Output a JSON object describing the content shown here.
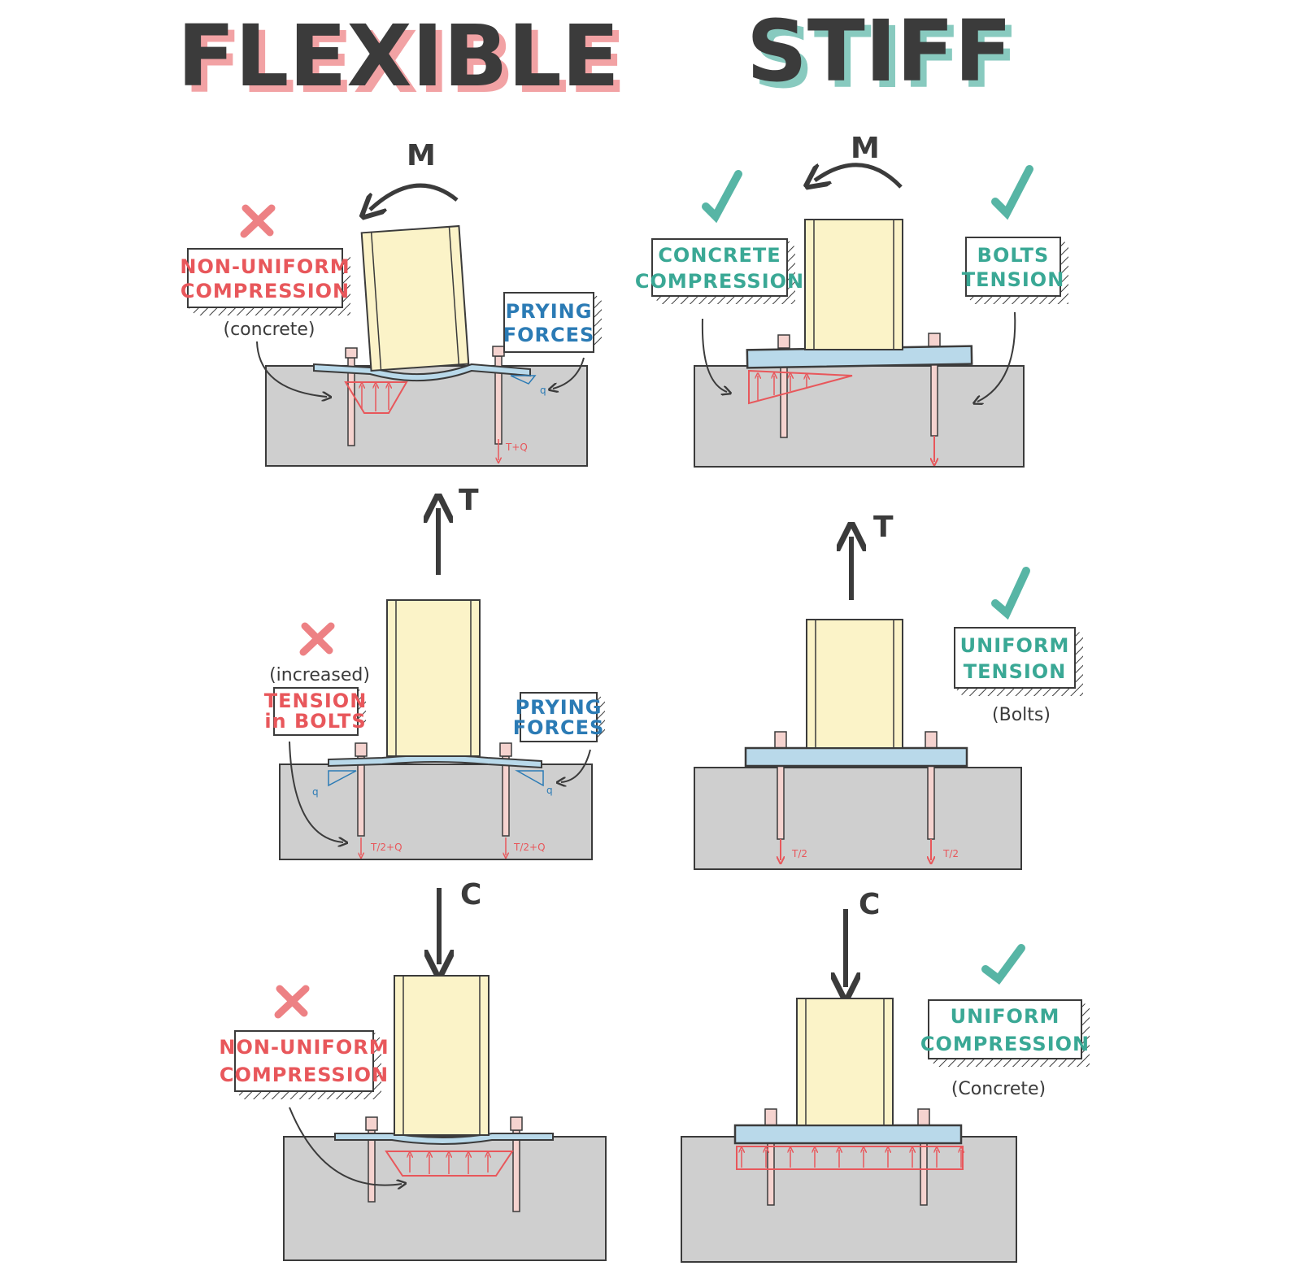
{
  "titles": {
    "left": "FLEXIBLE",
    "right": "STIFF"
  },
  "colors": {
    "flexible": "#e8575b",
    "stiff": "#3aa895",
    "blue": "#2b7bb5",
    "ink": "#3b3b3b",
    "concrete": "#cfcfcf",
    "column": "#fbf3c8",
    "plate": "#b9d9ea",
    "bolt": "#f5d3cf"
  },
  "force_labels": {
    "moment": "M",
    "tension": "T",
    "compression": "C"
  },
  "flexible": {
    "moment": {
      "mark": "x",
      "box_main": [
        "NON-UNIFORM",
        "COMPRESSION"
      ],
      "box_main_note": "(concrete)",
      "box_prying": [
        "PRYING",
        "FORCES"
      ],
      "q_label": "q",
      "bolt_force": "T+Q"
    },
    "tension": {
      "mark": "x",
      "box_main_note": "(increased)",
      "box_main": [
        "TENSION",
        "in BOLTS"
      ],
      "box_prying": [
        "PRYING",
        "FORCES"
      ],
      "q_left": "q",
      "q_right": "q",
      "bolt_force_left": "T/2+Q",
      "bolt_force_right": "T/2+Q"
    },
    "compression": {
      "mark": "x",
      "box_main": [
        "NON-UNIFORM",
        "COMPRESSION"
      ]
    }
  },
  "stiff": {
    "moment": {
      "mark": "check",
      "box_left": [
        "CONCRETE",
        "COMPRESSION"
      ],
      "box_right": [
        "BOLTS",
        "TENSION"
      ]
    },
    "tension": {
      "mark": "check",
      "box_main": [
        "UNIFORM",
        "TENSION"
      ],
      "box_note": "(Bolts)",
      "bolt_force_left": "T/2",
      "bolt_force_right": "T/2"
    },
    "compression": {
      "mark": "check",
      "box_main": [
        "UNIFORM",
        "COMPRESSION"
      ],
      "box_note": "(Concrete)"
    }
  }
}
